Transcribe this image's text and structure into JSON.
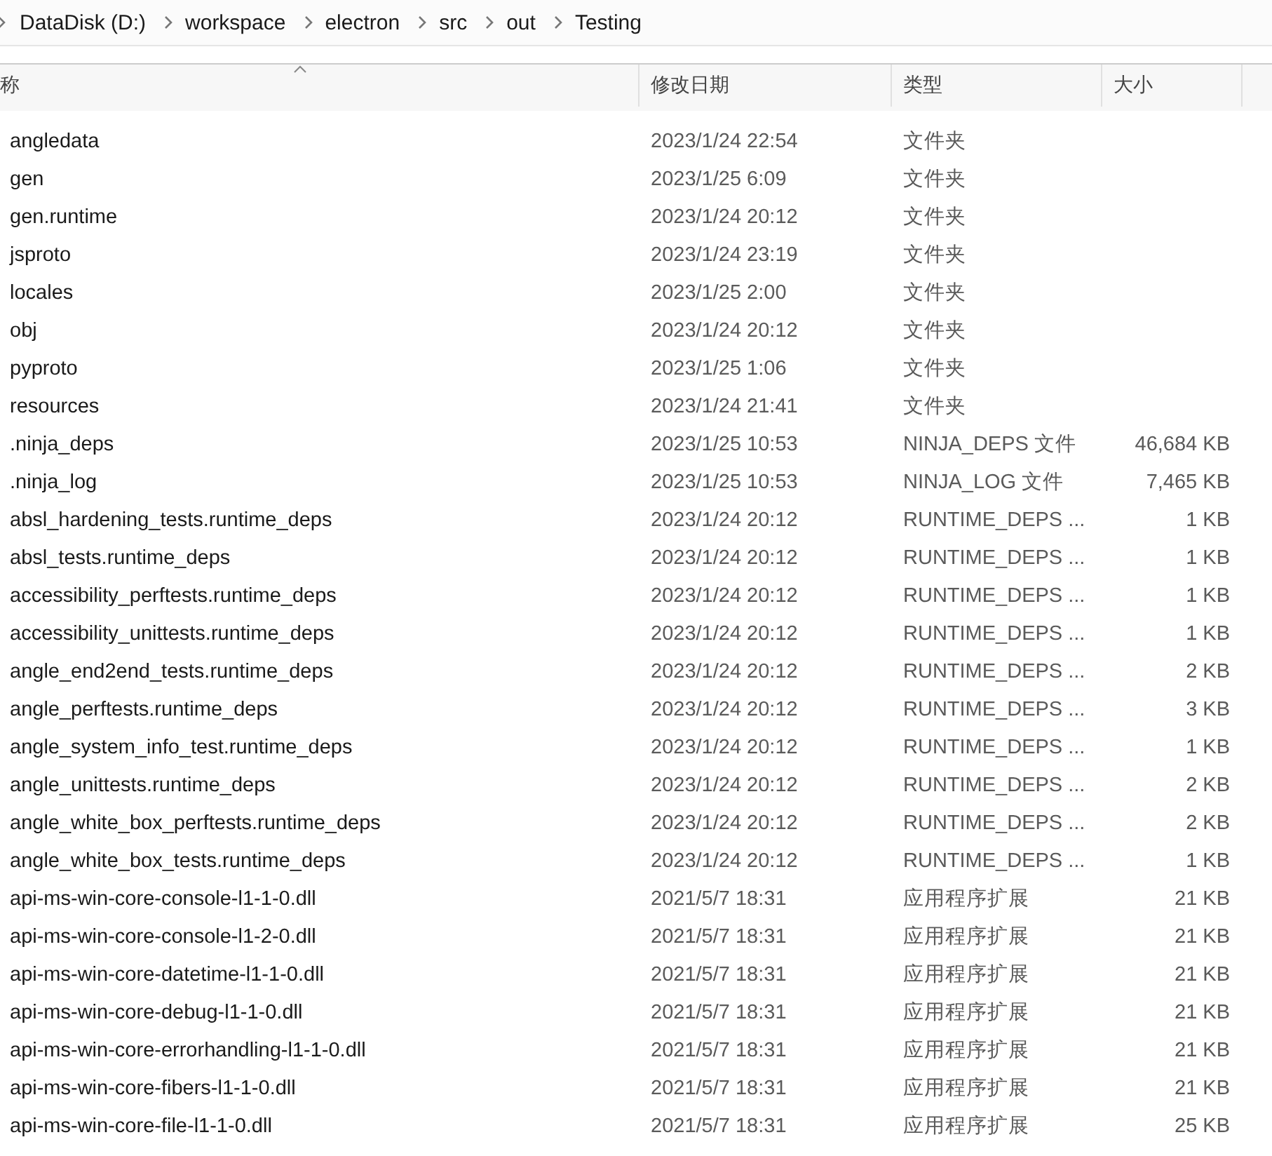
{
  "breadcrumb": [
    "DataDisk (D:)",
    "workspace",
    "electron",
    "src",
    "out",
    "Testing"
  ],
  "columns": [
    {
      "label": "称",
      "sorted": true
    },
    {
      "label": "修改日期",
      "sorted": false
    },
    {
      "label": "类型",
      "sorted": false
    },
    {
      "label": "大小",
      "sorted": false
    }
  ],
  "rows": [
    {
      "name": "angledata",
      "date": "2023/1/24 22:54",
      "type": "文件夹"
    },
    {
      "name": "gen",
      "date": "2023/1/25 6:09",
      "type": "文件夹"
    },
    {
      "name": "gen.runtime",
      "date": "2023/1/24 20:12",
      "type": "文件夹"
    },
    {
      "name": "jsproto",
      "date": "2023/1/24 23:19",
      "type": "文件夹"
    },
    {
      "name": "locales",
      "date": "2023/1/25 2:00",
      "type": "文件夹"
    },
    {
      "name": "obj",
      "date": "2023/1/24 20:12",
      "type": "文件夹"
    },
    {
      "name": "pyproto",
      "date": "2023/1/25 1:06",
      "type": "文件夹"
    },
    {
      "name": "resources",
      "date": "2023/1/24 21:41",
      "type": "文件夹"
    },
    {
      "name": ".ninja_deps",
      "date": "2023/1/25 10:53",
      "type": "NINJA_DEPS 文件",
      "size": "46,684 KB"
    },
    {
      "name": ".ninja_log",
      "date": "2023/1/25 10:53",
      "type": "NINJA_LOG 文件",
      "size": "7,465 KB"
    },
    {
      "name": "absl_hardening_tests.runtime_deps",
      "date": "2023/1/24 20:12",
      "type": "RUNTIME_DEPS ...",
      "size": "1 KB"
    },
    {
      "name": "absl_tests.runtime_deps",
      "date": "2023/1/24 20:12",
      "type": "RUNTIME_DEPS ...",
      "size": "1 KB"
    },
    {
      "name": "accessibility_perftests.runtime_deps",
      "date": "2023/1/24 20:12",
      "type": "RUNTIME_DEPS ...",
      "size": "1 KB"
    },
    {
      "name": "accessibility_unittests.runtime_deps",
      "date": "2023/1/24 20:12",
      "type": "RUNTIME_DEPS ...",
      "size": "1 KB"
    },
    {
      "name": "angle_end2end_tests.runtime_deps",
      "date": "2023/1/24 20:12",
      "type": "RUNTIME_DEPS ...",
      "size": "2 KB"
    },
    {
      "name": "angle_perftests.runtime_deps",
      "date": "2023/1/24 20:12",
      "type": "RUNTIME_DEPS ...",
      "size": "3 KB"
    },
    {
      "name": "angle_system_info_test.runtime_deps",
      "date": "2023/1/24 20:12",
      "type": "RUNTIME_DEPS ...",
      "size": "1 KB"
    },
    {
      "name": "angle_unittests.runtime_deps",
      "date": "2023/1/24 20:12",
      "type": "RUNTIME_DEPS ...",
      "size": "2 KB"
    },
    {
      "name": "angle_white_box_perftests.runtime_deps",
      "date": "2023/1/24 20:12",
      "type": "RUNTIME_DEPS ...",
      "size": "2 KB"
    },
    {
      "name": "angle_white_box_tests.runtime_deps",
      "date": "2023/1/24 20:12",
      "type": "RUNTIME_DEPS ...",
      "size": "1 KB"
    },
    {
      "name": "api-ms-win-core-console-l1-1-0.dll",
      "date": "2021/5/7 18:31",
      "type": "应用程序扩展",
      "size": "21 KB"
    },
    {
      "name": "api-ms-win-core-console-l1-2-0.dll",
      "date": "2021/5/7 18:31",
      "type": "应用程序扩展",
      "size": "21 KB"
    },
    {
      "name": "api-ms-win-core-datetime-l1-1-0.dll",
      "date": "2021/5/7 18:31",
      "type": "应用程序扩展",
      "size": "21 KB"
    },
    {
      "name": "api-ms-win-core-debug-l1-1-0.dll",
      "date": "2021/5/7 18:31",
      "type": "应用程序扩展",
      "size": "21 KB"
    },
    {
      "name": "api-ms-win-core-errorhandling-l1-1-0.dll",
      "date": "2021/5/7 18:31",
      "type": "应用程序扩展",
      "size": "21 KB"
    },
    {
      "name": "api-ms-win-core-fibers-l1-1-0.dll",
      "date": "2021/5/7 18:31",
      "type": "应用程序扩展",
      "size": "21 KB"
    },
    {
      "name": "api-ms-win-core-file-l1-1-0.dll",
      "date": "2021/5/7 18:31",
      "type": "应用程序扩展",
      "size": "25 KB"
    }
  ]
}
